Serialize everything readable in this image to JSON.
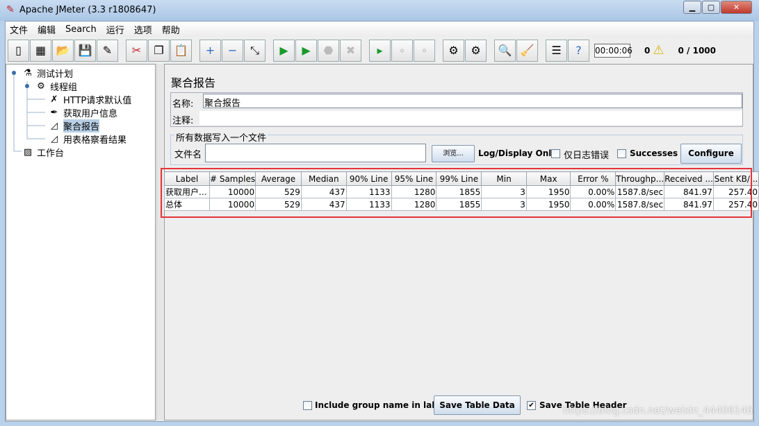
{
  "window": {
    "title": "Apache JMeter (3.3 r1808647)",
    "minimize": "▁",
    "maximize": "▢",
    "close": "✕"
  },
  "menu": [
    "文件",
    "编辑",
    "Search",
    "运行",
    "选项",
    "帮助"
  ],
  "toolbar": {
    "timer": "00:00:06",
    "warnings": "0",
    "threads": "0 / 1000",
    "groups": [
      [
        "new",
        "templates",
        "open",
        "save",
        "save-as"
      ],
      [
        "cut",
        "copy",
        "paste"
      ],
      [
        "expand",
        "collapse",
        "toggle"
      ],
      [
        "start",
        "start-no-pauses",
        "stop",
        "shutdown"
      ],
      [
        "remote-start-all",
        "remote-stop-all",
        "remote-shutdown-all"
      ],
      [
        "clear",
        "clear-all"
      ],
      [
        "search",
        "reset-search"
      ],
      [
        "function-helper",
        "help"
      ]
    ]
  },
  "tree": {
    "items": [
      {
        "label": "测试计划",
        "icon": "flask-icon"
      },
      {
        "label": "线程组",
        "icon": "gear-icon"
      },
      {
        "label": "HTTP请求默认值",
        "icon": "tools-icon"
      },
      {
        "label": "获取用户信息",
        "icon": "pipette-icon"
      },
      {
        "label": "聚合报告",
        "icon": "graph-icon",
        "selected": true
      },
      {
        "label": "用表格察看结果",
        "icon": "graph-icon"
      },
      {
        "label": "工作台",
        "icon": "clipboard-icon"
      }
    ]
  },
  "panel": {
    "title": "聚合报告",
    "name_label": "名称:",
    "name_value": "聚合报告",
    "comment_label": "注释:",
    "comment_value": "",
    "file_legend": "所有数据写入一个文件",
    "file_label": "文件名",
    "file_value": "",
    "browse": "浏览...",
    "log_display": "Log/Display Only:",
    "errors_only": "仅日志错误",
    "successes": "Successes",
    "configure": "Configure"
  },
  "table": {
    "columns": [
      "Label",
      "# Samples",
      "Average",
      "Median",
      "90% Line",
      "95% Line",
      "99% Line",
      "Min",
      "Max",
      "Error %",
      "Throughp...",
      "Received ...",
      "Sent KB/..."
    ],
    "rows": [
      [
        "获取用户...",
        "10000",
        "529",
        "437",
        "1133",
        "1280",
        "1855",
        "3",
        "1950",
        "0.00%",
        "1587.8/sec",
        "841.97",
        "257.40"
      ],
      [
        "总体",
        "10000",
        "529",
        "437",
        "1133",
        "1280",
        "1855",
        "3",
        "1950",
        "0.00%",
        "1587.8/sec",
        "841.97",
        "257.40"
      ]
    ]
  },
  "bottom": {
    "include_group": "Include group name in label?",
    "include_group_checked": false,
    "save_table": "Save Table Data",
    "save_header": "Save Table Header",
    "save_header_checked": true
  },
  "watermark": "https://blog.csdn.net/weixin_44406146"
}
